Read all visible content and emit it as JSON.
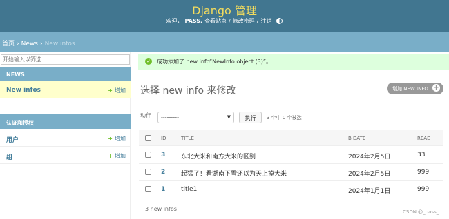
{
  "header": {
    "brand": "Django 管理",
    "welcome": "欢迎，",
    "username": "PASS.",
    "view_site": "查看站点",
    "sep1": "/",
    "change_password": "修改密码",
    "sep2": "/",
    "logout": "注销"
  },
  "breadcrumb": {
    "home": "首页",
    "app": "News",
    "current": "New infos",
    "sep": "›"
  },
  "sidebar": {
    "filter_placeholder": "开始输入以筛选...",
    "modules": [
      {
        "caption": "NEWS",
        "items": [
          {
            "name": "New infos",
            "add": "增加"
          }
        ]
      },
      {
        "caption": "认证和授权",
        "items": [
          {
            "name": "用户",
            "add": "增加"
          },
          {
            "name": "组",
            "add": "增加"
          }
        ]
      }
    ]
  },
  "message": {
    "text": "成功添加了 new info“NewInfo object (3)”。",
    "icon": "check-icon"
  },
  "main": {
    "title": "选择 new info 来修改",
    "add_button": "增加 NEW INFO",
    "actions_label": "动作",
    "action_selected": "---------",
    "go_button": "执行",
    "selection_counter": "3 个中 0 个被选",
    "columns": [
      "ID",
      "TITLE",
      "B DATE",
      "READ"
    ],
    "rows": [
      {
        "id": "3",
        "title": "东北大米和南方大米的区别",
        "date": "2024年2月5日",
        "read": "33"
      },
      {
        "id": "2",
        "title": "起猛了！看湖南下雪还以为天上掉大米",
        "date": "2024年2月5日",
        "read": "999"
      },
      {
        "id": "1",
        "title": "title1",
        "date": "2024年1月1日",
        "read": "999"
      }
    ],
    "result_count": "3 new infos"
  },
  "watermark": "CSDN @_pass_",
  "colors": {
    "header": "#417690",
    "brand": "#f5dd5d",
    "breadcrumb": "#79aec8",
    "link": "#447e9b",
    "success": "#dfd",
    "add_plus": "#70bf2b"
  }
}
